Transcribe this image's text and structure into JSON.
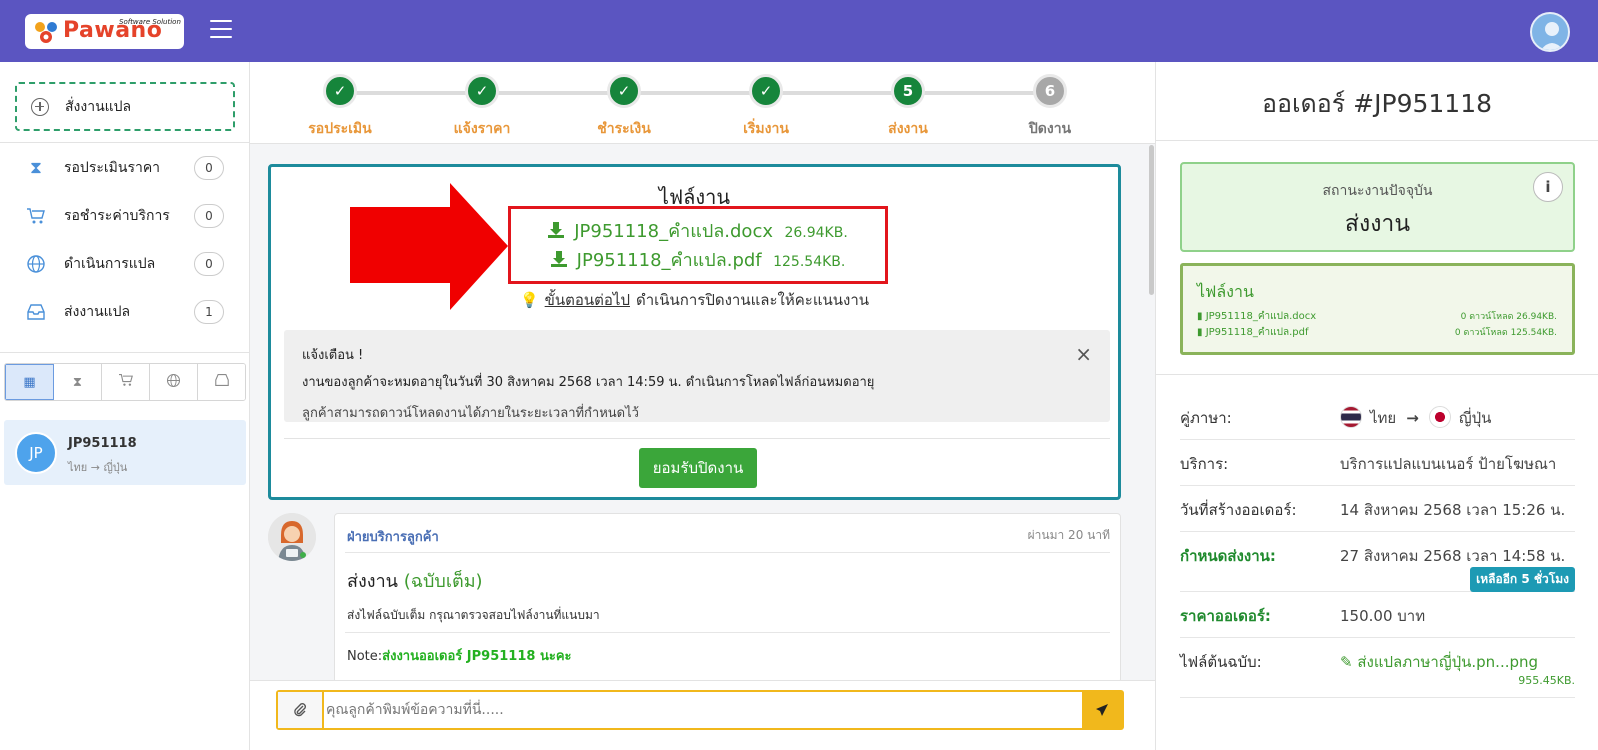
{
  "brand": {
    "name": "Pawano",
    "tagline": "Software Solution"
  },
  "sidebar": {
    "new_order_label": "สั่งงานแปล",
    "items": [
      {
        "label": "รอประเมินราคา",
        "count": "0",
        "icon": "hourglass-icon"
      },
      {
        "label": "รอชำระค่าบริการ",
        "count": "0",
        "icon": "cart-icon"
      },
      {
        "label": "ดำเนินการแปล",
        "count": "0",
        "icon": "globe-icon"
      },
      {
        "label": "ส่งงานแปล",
        "count": "1",
        "icon": "inbox-icon"
      }
    ],
    "filter_tabs": [
      "grid-icon",
      "hourglass-icon",
      "cart-icon",
      "globe-icon",
      "inbox-icon"
    ],
    "order": {
      "avatar": "JP",
      "id": "JP951118",
      "lang": "ไทย → ญี่ปุ่น"
    }
  },
  "steps": [
    {
      "label": "รอประเมิน",
      "mark": "✓",
      "state": "done"
    },
    {
      "label": "แจ้งราคา",
      "mark": "✓",
      "state": "done"
    },
    {
      "label": "ชำระเงิน",
      "mark": "✓",
      "state": "done"
    },
    {
      "label": "เริ่มงาน",
      "mark": "✓",
      "state": "done"
    },
    {
      "label": "ส่งงาน",
      "mark": "5",
      "state": "active"
    },
    {
      "label": "ปิดงาน",
      "mark": "6",
      "state": "pending"
    }
  ],
  "file_box": {
    "title": "ไฟล์งาน",
    "files": [
      {
        "name": "JP951118_คำแปล.docx",
        "size": "26.94KB."
      },
      {
        "name": "JP951118_คำแปล.pdf",
        "size": "125.54KB."
      }
    ],
    "next_step_link": "ขั้นตอนต่อไป",
    "next_step_text": "ดำเนินการปิดงานและให้คะแนนงาน",
    "alert": {
      "title": "แจ้งเตือน !",
      "line1": "งานของลูกค้าจะหมดอายุในวันที่ 30 สิงหาคม 2568 เวลา 14:59 น. ดำเนินการโหลดไฟล์ก่อนหมดอายุ",
      "line2": "ลูกค้าสามารถดาวน์โหลดงานได้ภายในระยะเวลาที่กำหนดไว้",
      "close": "×"
    },
    "accept_label": "ยอมรับปิดงาน"
  },
  "message": {
    "sender": "ฝ่ายบริการลูกค้า",
    "time": "ผ่านมา 20 นาที",
    "title": "ส่งงาน",
    "title_version": "(ฉบับเต็ม)",
    "text": "ส่งไฟล์ฉบับเต็ม กรุณาตรวจสอบไฟล์งานที่แนบมา",
    "note_prefix": "Note:",
    "note_text": "ส่งงานออเดอร์ JP951118 นะคะ"
  },
  "composer": {
    "placeholder": "คุณลูกค้าพิมพ์ข้อความที่นี่....."
  },
  "right": {
    "order_title": "ออเดอร์ #JP951118",
    "status_label": "สถานะงานปัจจุบัน",
    "status_value": "ส่งงาน",
    "info_icon": "i",
    "files_title": "ไฟล์งาน",
    "files": [
      {
        "name": "JP951118_คำแปล.docx",
        "downloads": "0 ดาวน์โหลด 26.94KB."
      },
      {
        "name": "JP951118_คำแปล.pdf",
        "downloads": "0 ดาวน์โหลด 125.54KB."
      }
    ],
    "lang_label": "คู่ภาษา:",
    "lang_from": "ไทย",
    "lang_arrow": "→",
    "lang_to": "ญี่ปุ่น",
    "service_label": "บริการ:",
    "service_value": "บริการแปลแบนเนอร์ ป้ายโฆษณา",
    "created_label": "วันที่สร้างออเดอร์:",
    "created_value": "14 สิงหาคม 2568 เวลา 15:26 น.",
    "due_label": "กำหนดส่งงาน:",
    "due_value": "27 สิงหาคม 2568 เวลา 14:58 น.",
    "due_badge": "เหลืออีก 5 ชั่วโมง",
    "price_label": "ราคาออเดอร์:",
    "price_value": "150.00 บาท",
    "source_label": "ไฟล์ต้นฉบับ:",
    "source_file": "ส่งแปลภาษาญี่ปุ่น.pn...png",
    "source_size": "955.45KB."
  },
  "colors": {
    "topbar": "#5b55c1",
    "accent_green": "#3e9a2f",
    "step_orange": "#e8973a",
    "highlight_red": "#e2151c",
    "teal": "#1d8b9c",
    "yellow": "#f1b81c"
  }
}
